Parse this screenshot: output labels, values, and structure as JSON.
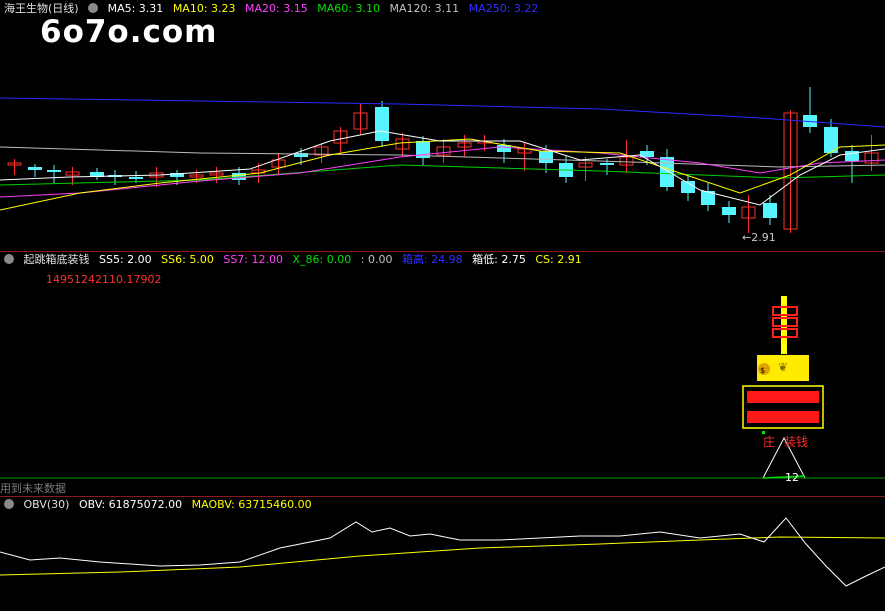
{
  "main": {
    "title": "海王生物(日线)",
    "ma": [
      {
        "label": "MA5: 3.31",
        "color": "#ffffff"
      },
      {
        "label": "MA10: 3.23",
        "color": "#ffff00"
      },
      {
        "label": "MA20: 3.15",
        "color": "#ff40ff"
      },
      {
        "label": "MA60: 3.10",
        "color": "#00e000"
      },
      {
        "label": "MA120: 3.11",
        "color": "#c0c0c0"
      },
      {
        "label": "MA250: 3.22",
        "color": "#3030ff"
      }
    ],
    "watermark": "6o7o.com",
    "low_label": "←2.91"
  },
  "indicator": {
    "title": "起跳箱底装钱",
    "values": [
      {
        "label": "SS5: 2.00",
        "color": "#ffffff"
      },
      {
        "label": "SS6: 5.00",
        "color": "#ffff00"
      },
      {
        "label": "SS7: 12.00",
        "color": "#ff40ff"
      },
      {
        "label": "X_86: 0.00",
        "color": "#00e000"
      },
      {
        "label": ": 0.00",
        "color": "#c0c0c0"
      },
      {
        "label": "箱高: 24.98",
        "color": "#3030ff"
      },
      {
        "label": "箱低: 2.75",
        "color": "#ffffff"
      },
      {
        "label": "CS: 2.91",
        "color": "#ffff00"
      }
    ],
    "big_number": "14951242110.17902",
    "zhuang_label": "庄",
    "zhuangqian_label": "装钱",
    "twelve": "12",
    "future_note": "用到未来数据"
  },
  "obv": {
    "title": "OBV(30)",
    "obv_value": "OBV: 61875072.00",
    "maobv_value": "MAOBV: 63715460.00",
    "obv_color": "#ffffff",
    "maobv_color": "#ffff00"
  }
}
